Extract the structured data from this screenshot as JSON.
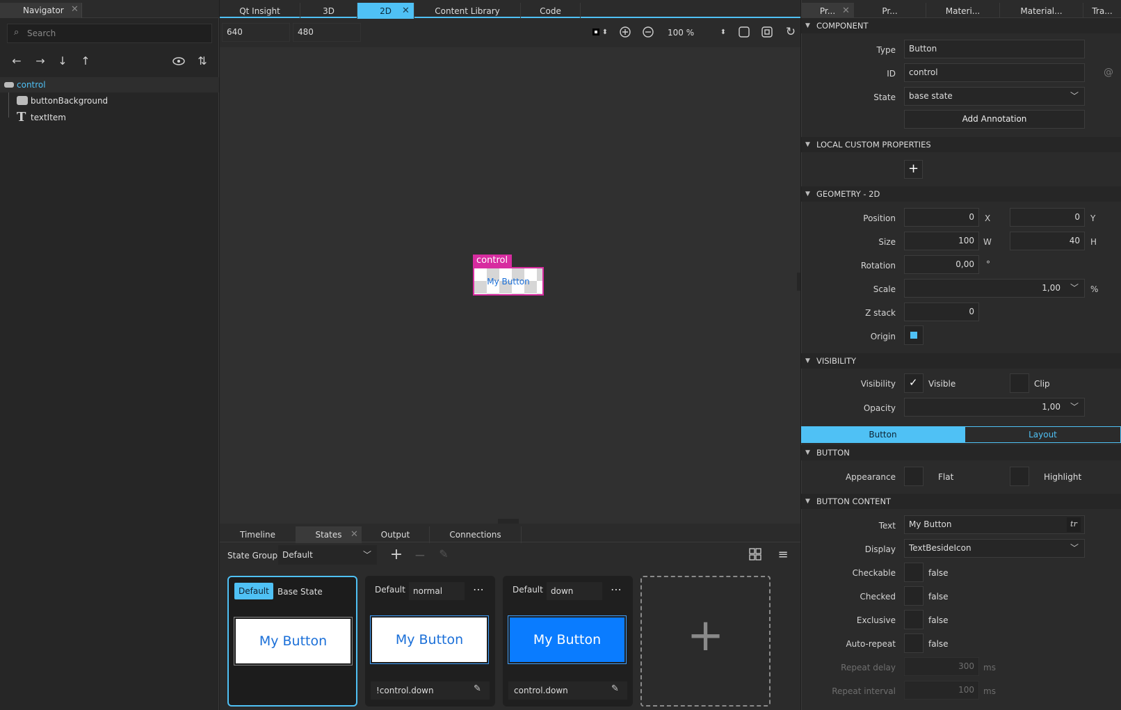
{
  "navigator": {
    "tab": "Navigator",
    "search_placeholder": "Search",
    "tree": [
      {
        "label": "control"
      },
      {
        "label": "buttonBackground"
      },
      {
        "label": "textItem"
      }
    ]
  },
  "center_tabs": [
    "Qt Insight",
    "3D",
    "2D",
    "Content Library",
    "Code"
  ],
  "toolbar": {
    "width": "640",
    "height": "480",
    "zoom": "100 %"
  },
  "canvas": {
    "selection_label": "control",
    "button_text": "My Button"
  },
  "bottom_tabs": [
    "Timeline",
    "States",
    "Output",
    "Connections"
  ],
  "states": {
    "group_label": "State Group",
    "group_value": "Default",
    "cards": [
      {
        "badge": "Default",
        "name": "Base State",
        "preview": "My Button",
        "when": ""
      },
      {
        "badge": "Default",
        "name": "normal",
        "preview": "My Button",
        "when": "!control.down"
      },
      {
        "badge": "Default",
        "name": "down",
        "preview": "My Button",
        "when": "control.down"
      }
    ]
  },
  "right_tabs": [
    "Pr...",
    "Pr...",
    "Materi...",
    "Material...",
    "Tra..."
  ],
  "component": {
    "title": "COMPONENT",
    "type_label": "Type",
    "type_value": "Button",
    "id_label": "ID",
    "id_value": "control",
    "state_label": "State",
    "state_value": "base state",
    "annotation": "Add Annotation"
  },
  "local_custom": {
    "title": "LOCAL CUSTOM PROPERTIES"
  },
  "geometry": {
    "title": "GEOMETRY - 2D",
    "position_label": "Position",
    "x": "0",
    "x_unit": "X",
    "y": "0",
    "y_unit": "Y",
    "size_label": "Size",
    "w": "100",
    "w_unit": "W",
    "h": "40",
    "h_unit": "H",
    "rotation_label": "Rotation",
    "rotation": "0,00",
    "rotation_unit": "°",
    "scale_label": "Scale",
    "scale": "1,00",
    "scale_unit": "%",
    "z_label": "Z stack",
    "z": "0",
    "origin_label": "Origin"
  },
  "visibility": {
    "title": "VISIBILITY",
    "visibility_label": "Visibility",
    "visible": "Visible",
    "clip": "Clip",
    "opacity_label": "Opacity",
    "opacity": "1,00"
  },
  "subtabs": [
    "Button",
    "Layout"
  ],
  "button": {
    "title": "BUTTON",
    "appearance_label": "Appearance",
    "flat": "Flat",
    "highlight": "Highlight"
  },
  "button_content": {
    "title": "BUTTON CONTENT",
    "text_label": "Text",
    "text_value": "My Button",
    "tr": "tr",
    "display_label": "Display",
    "display_value": "TextBesideIcon",
    "checkable_label": "Checkable",
    "checkable": "false",
    "checked_label": "Checked",
    "checked": "false",
    "exclusive_label": "Exclusive",
    "exclusive": "false",
    "autorepeat_label": "Auto-repeat",
    "autorepeat": "false",
    "repeat_delay_label": "Repeat delay",
    "repeat_delay": "300",
    "repeat_delay_unit": "ms",
    "repeat_interval_label": "Repeat interval",
    "repeat_interval": "100",
    "repeat_interval_unit": "ms"
  },
  "colors": {
    "accent": "#4fc1f5",
    "selection": "#d72ca0",
    "button_blue": "#0a7cff"
  }
}
